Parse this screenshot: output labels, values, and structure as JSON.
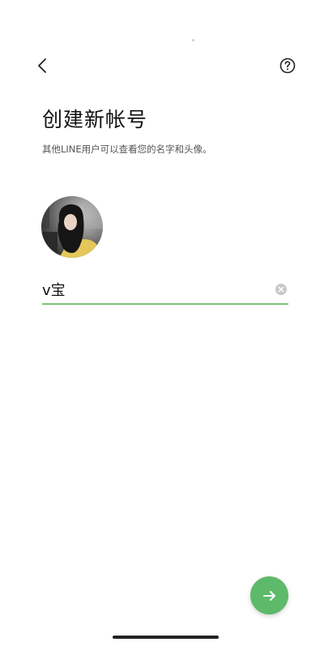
{
  "header": {
    "back_icon": "chevron-left-icon",
    "help_icon": "question-circle-icon"
  },
  "main": {
    "title": "创建新帐号",
    "subtitle": "其他LINE用户可以查看您的名字和头像。"
  },
  "profile": {
    "avatar_icon": "profile-photo"
  },
  "name_field": {
    "value": "v宝",
    "clear_icon": "clear-circle-icon"
  },
  "footer": {
    "next_icon": "arrow-right-icon"
  },
  "colors": {
    "accent": "#5dba6a",
    "underline": "#7bc47a",
    "text": "#111111",
    "subtext": "#555555"
  }
}
